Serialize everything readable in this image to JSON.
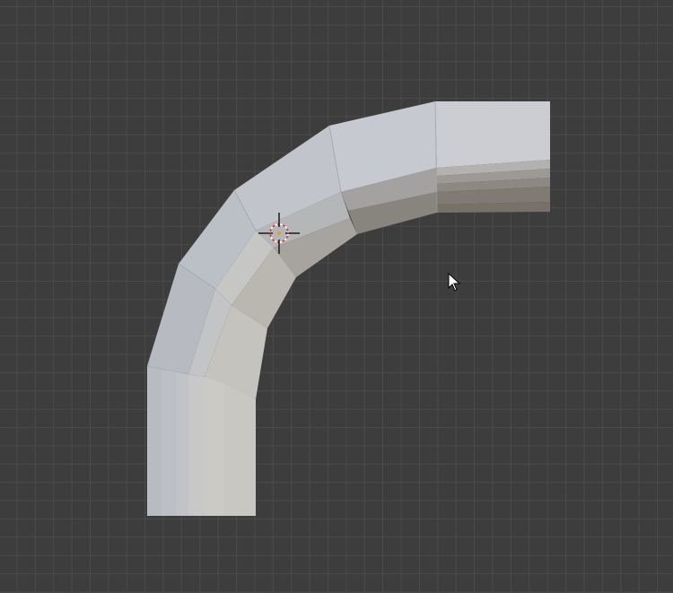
{
  "viewport": {
    "background_color": "#3d3d3d",
    "grid_color": "#4a4a4a",
    "mode": "3d-viewport"
  },
  "object": {
    "type": "curved-pipe-mesh",
    "shading": "solid",
    "base_color": "#c7c9cf",
    "shadow_color": "#7a7669"
  },
  "cursor_3d": {
    "icon": "3d-cursor-icon",
    "ring_colors": [
      "#d23a3a",
      "#ffffff"
    ]
  },
  "mouse_pointer": {
    "icon": "arrow-pointer-icon",
    "color": "#ffffff"
  }
}
